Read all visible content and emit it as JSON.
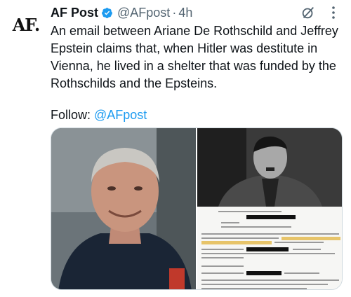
{
  "author": {
    "avatar_text": "AF.",
    "name": "AF Post",
    "handle": "@AFpost",
    "separator": "·",
    "time": "4h"
  },
  "tweet": {
    "text": "An email between Ariane De Rothschild and Jeffrey Epstein claims that, when Hitler was destitute in Vienna, he lived in a shelter that was funded by the Rothschilds and the Epsteins.",
    "follow_label": "Follow: ",
    "follow_link": "@AFpost"
  },
  "icons": {
    "verified": "verified-badge-icon",
    "grok": "grok-icon",
    "more": "more-icon"
  },
  "colors": {
    "accent": "#1d9bf0",
    "muted": "#536471",
    "text": "#0f1419"
  }
}
